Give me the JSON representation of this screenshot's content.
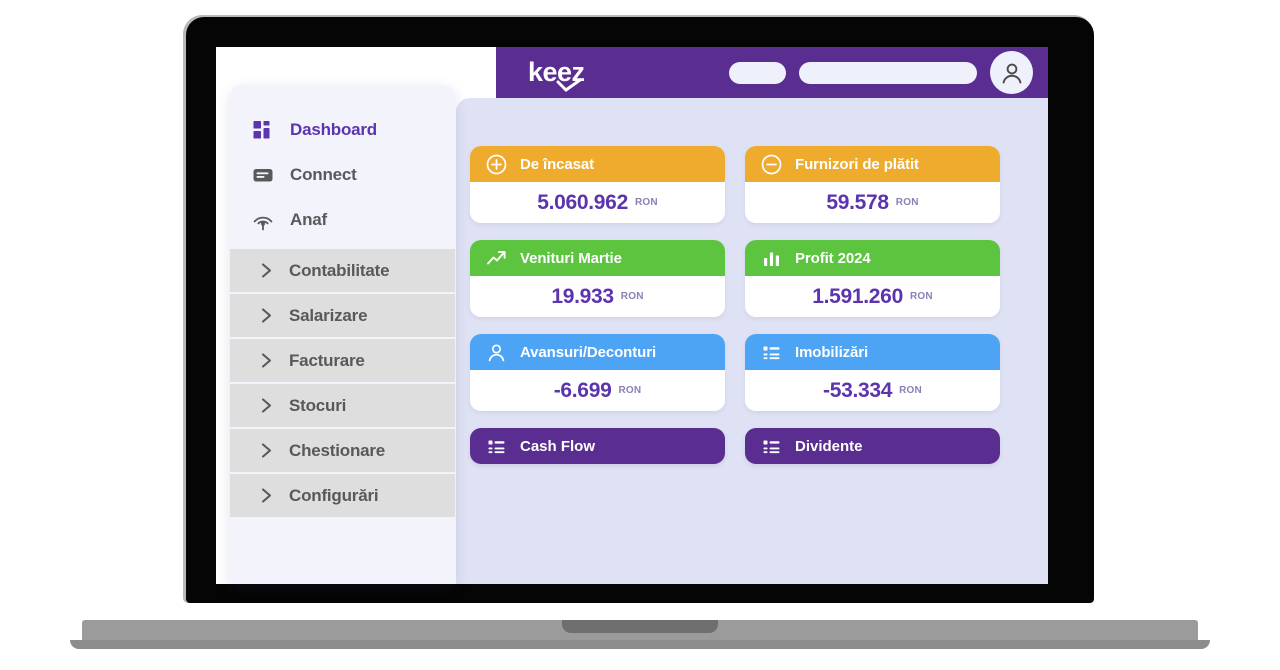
{
  "header": {
    "brand": "keez",
    "brand_color": "#5a2d91",
    "avatar_icon": "user-icon",
    "pills": [
      "",
      ""
    ]
  },
  "sidebar": {
    "items": [
      {
        "label": "Dashboard",
        "icon": "grid-icon",
        "active": true
      },
      {
        "label": "Connect",
        "icon": "message-card-icon",
        "active": false
      },
      {
        "label": "Anaf",
        "icon": "signal-icon",
        "active": false
      }
    ],
    "groups": [
      {
        "label": "Contabilitate",
        "icon": "chevron-right-icon"
      },
      {
        "label": "Salarizare",
        "icon": "chevron-right-icon"
      },
      {
        "label": "Facturare",
        "icon": "chevron-right-icon"
      },
      {
        "label": "Stocuri",
        "icon": "chevron-right-icon"
      },
      {
        "label": "Chestionare",
        "icon": "chevron-right-icon"
      },
      {
        "label": "Configurări",
        "icon": "chevron-right-icon"
      }
    ]
  },
  "dashboard": {
    "cards": [
      {
        "title": "De încasat",
        "icon": "plus-circle-icon",
        "color": "#eeab2e",
        "value": "5.060.962",
        "currency": "RON"
      },
      {
        "title": "Furnizori de plătit",
        "icon": "minus-circle-icon",
        "color": "#eeab2e",
        "value": "59.578",
        "currency": "RON"
      },
      {
        "title": "Venituri Martie",
        "icon": "trending-up-icon",
        "color": "#5cc43f",
        "value": "19.933",
        "currency": "RON"
      },
      {
        "title": "Profit 2024",
        "icon": "bar-chart-icon",
        "color": "#5cc43f",
        "value": "1.591.260",
        "currency": "RON"
      },
      {
        "title": "Avansuri/Deconturi",
        "icon": "user-icon",
        "color": "#4da4f5",
        "value": "-6.699",
        "currency": "RON"
      },
      {
        "title": "Imobilizări",
        "icon": "list-icon",
        "color": "#4da4f5",
        "value": "-53.334",
        "currency": "RON"
      }
    ],
    "actions": [
      {
        "title": "Cash Flow",
        "icon": "list-icon",
        "color": "#5a2d91"
      },
      {
        "title": "Dividente",
        "icon": "list-icon",
        "color": "#5a2d91"
      }
    ]
  },
  "theme": {
    "purple": "#5a2d91",
    "value_purple": "#5b34ae",
    "content_bg": "#dfe2f4",
    "sidebar_bg": "#f3f3fc",
    "group_bg": "#dedede"
  }
}
